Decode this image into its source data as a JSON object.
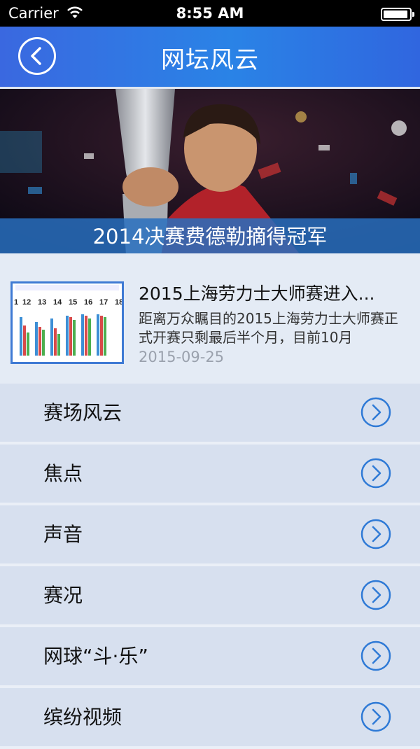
{
  "status_bar": {
    "carrier": "Carrier",
    "time": "8:55 AM"
  },
  "nav": {
    "title": "网坛风云",
    "back_icon": "chevron-left-icon"
  },
  "banner": {
    "caption": "2014决赛费德勒摘得冠军"
  },
  "news": {
    "headline": "2015上海劳力士大师赛进入...",
    "summary": "距离万众瞩目的2015上海劳力士大师赛正式开赛只剩最后半个月，目前10月",
    "date": "2015-09-25"
  },
  "menu": {
    "items": [
      {
        "label": "赛场风云"
      },
      {
        "label": "焦点"
      },
      {
        "label": "声音"
      },
      {
        "label": "赛况"
      },
      {
        "label": "网球“斗·乐”"
      },
      {
        "label": "缤纷视频"
      }
    ]
  },
  "colors": {
    "accent": "#2f7ad6",
    "nav": "#3a68e0",
    "row": "#d7e0ef"
  }
}
